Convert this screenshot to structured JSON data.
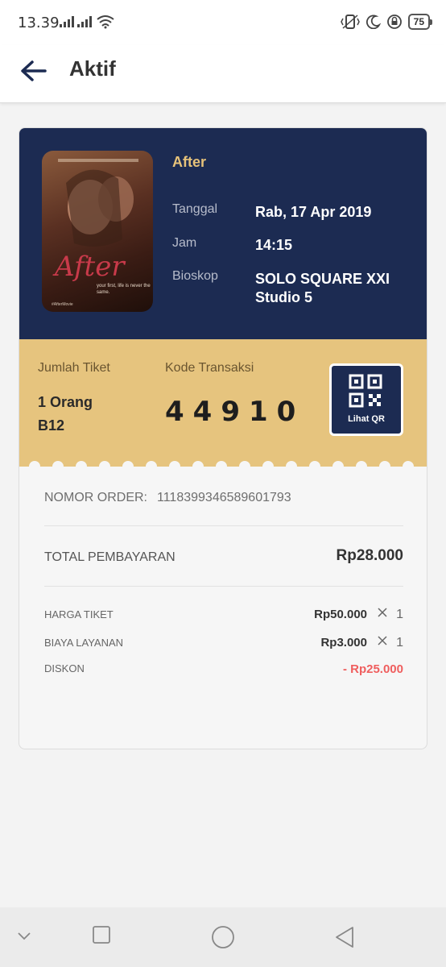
{
  "status_bar": {
    "time": "13.39",
    "battery": "75"
  },
  "header": {
    "title": "Aktif"
  },
  "ticket": {
    "poster": {
      "title": "After",
      "tagline": "your first, life is never the same.",
      "hashtag": "#AfterMovie"
    },
    "movie_title": "After",
    "date_label": "Tanggal",
    "date_value": "Rab, 17 Apr 2019",
    "time_label": "Jam",
    "time_value": "14:15",
    "cinema_label": "Bioskop",
    "cinema_value_line1": "SOLO SQUARE XXI",
    "cinema_value_line2": "Studio 5",
    "ticket_count_label": "Jumlah Tiket",
    "ticket_count_value": "1 Orang",
    "seat": "B12",
    "transaction_label": "Kode Transaksi",
    "transaction_code": "44910",
    "qr_button_label": "Lihat QR"
  },
  "payment": {
    "order_label": "NOMOR ORDER:",
    "order_number": "1118399346589601793",
    "total_label": "TOTAL PEMBAYARAN",
    "total_value": "Rp28.000",
    "items": [
      {
        "label": "HARGA TIKET",
        "value": "Rp50.000",
        "qty": "1"
      },
      {
        "label": "BIAYA LAYANAN",
        "value": "Rp3.000",
        "qty": "1"
      },
      {
        "label": "DISKON",
        "value": "- Rp25.000"
      }
    ]
  },
  "icons": {
    "back": "arrow-left-icon",
    "qr": "qr-code-icon",
    "multiply": "multiply-icon",
    "nav": [
      "chevron-down-icon",
      "square-icon",
      "circle-icon",
      "triangle-back-icon"
    ]
  },
  "colors": {
    "navy": "#1c2b52",
    "gold": "#e6c47e",
    "title_gold": "#e6c27a",
    "discount_red": "#ef5e5e"
  }
}
